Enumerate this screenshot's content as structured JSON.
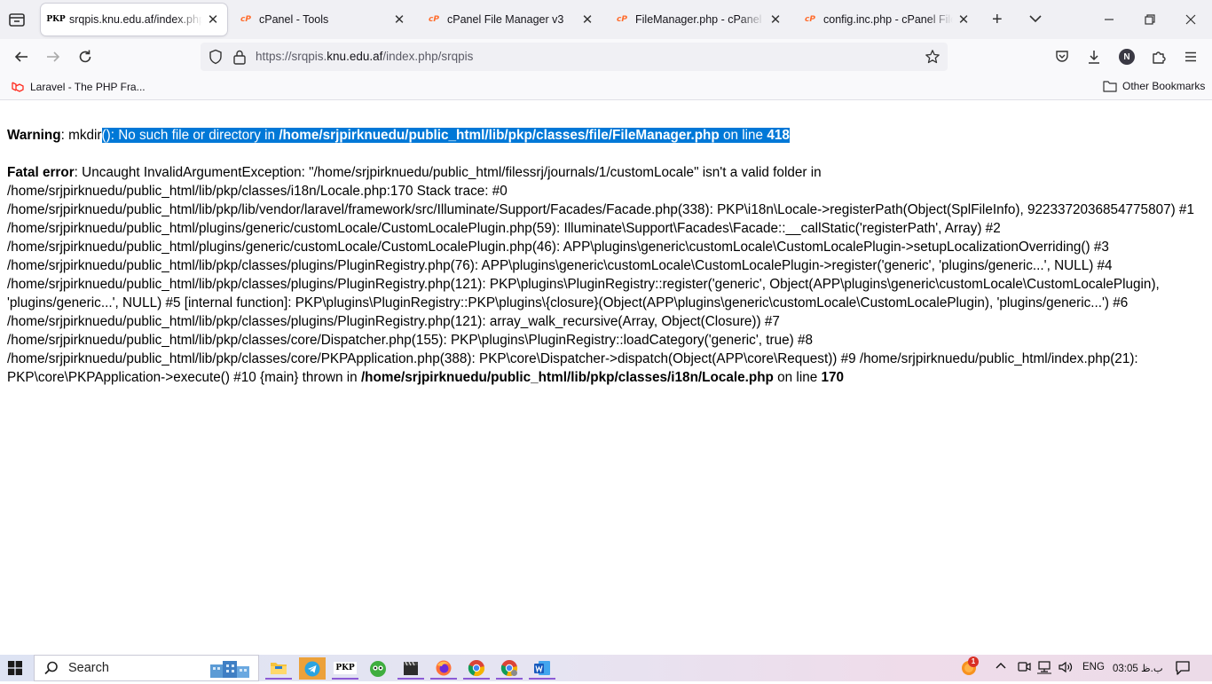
{
  "browser": {
    "tabs": [
      {
        "title": "srqpis.knu.edu.af/index.php/",
        "favicon": "PKP",
        "active": true
      },
      {
        "title": "cPanel - Tools",
        "favicon": "cP",
        "active": false
      },
      {
        "title": "cPanel File Manager v3",
        "favicon": "cP",
        "active": false
      },
      {
        "title": "FileManager.php - cPanel File",
        "favicon": "cP",
        "active": false
      },
      {
        "title": "config.inc.php - cPanel File M",
        "favicon": "cP",
        "active": false
      }
    ],
    "new_tab_symbol": "+",
    "url": {
      "scheme": "https://",
      "subdomain": "srqpis.",
      "host": "knu.edu.af",
      "path": "/index.php/srqpis"
    },
    "profile_initial": "N",
    "bookmarks": [
      {
        "label": "Laravel - The PHP Fra...",
        "icon": "laravel-icon"
      }
    ],
    "other_bookmarks": "Other Bookmarks"
  },
  "page": {
    "warning": {
      "label": "Warning",
      "sep": ": ",
      "func_before": "mkdir",
      "selected_plain": "(): No such file or directory in ",
      "selected_path": "/home/srjpirknuedu/public_html/lib/pkp/classes/file/FileManager.php",
      "selected_online": " on line ",
      "selected_line": "418"
    },
    "fatal": {
      "label": "Fatal error",
      "message": ": Uncaught InvalidArgumentException: \"/home/srjpirknuedu/public_html/filessrj/journals/1/customLocale\" isn't a valid folder in /home/srjpirknuedu/public_html/lib/pkp/classes/i18n/Locale.php:170 Stack trace: #0 /home/srjpirknuedu/public_html/lib/pkp/lib/vendor/laravel/framework/src/Illuminate/Support/Facades/Facade.php(338): PKP\\i18n\\Locale->registerPath(Object(SplFileInfo), 9223372036854775807) #1 /home/srjpirknuedu/public_html/plugins/generic/customLocale/CustomLocalePlugin.php(59): Illuminate\\Support\\Facades\\Facade::__callStatic('registerPath', Array) #2 /home/srjpirknuedu/public_html/plugins/generic/customLocale/CustomLocalePlugin.php(46): APP\\plugins\\generic\\customLocale\\CustomLocalePlugin->setupLocalizationOverriding() #3 /home/srjpirknuedu/public_html/lib/pkp/classes/plugins/PluginRegistry.php(76): APP\\plugins\\generic\\customLocale\\CustomLocalePlugin->register('generic', 'plugins/generic...', NULL) #4 /home/srjpirknuedu/public_html/lib/pkp/classes/plugins/PluginRegistry.php(121): PKP\\plugins\\PluginRegistry::register('generic', Object(APP\\plugins\\generic\\customLocale\\CustomLocalePlugin), 'plugins/generic...', NULL) #5 [internal function]: PKP\\plugins\\PluginRegistry::PKP\\plugins\\{closure}(Object(APP\\plugins\\generic\\customLocale\\CustomLocalePlugin), 'plugins/generic...') #6 /home/srjpirknuedu/public_html/lib/pkp/classes/plugins/PluginRegistry.php(121): array_walk_recursive(Array, Object(Closure)) #7 /home/srjpirknuedu/public_html/lib/pkp/classes/core/Dispatcher.php(155): PKP\\plugins\\PluginRegistry::loadCategory('generic', true) #8 /home/srjpirknuedu/public_html/lib/pkp/classes/core/PKPApplication.php(388): PKP\\core\\Dispatcher->dispatch(Object(APP\\core\\Request)) #9 /home/srjpirknuedu/public_html/index.php(21): PKP\\core\\PKPApplication->execute() #10 {main} thrown in ",
      "file": "/home/srjpirknuedu/public_html/lib/pkp/classes/i18n/Locale.php",
      "online": " on line ",
      "line": "170"
    }
  },
  "taskbar": {
    "search_placeholder": "Search",
    "apps": [
      "file-explorer-icon",
      "telegram-icon",
      "pkp-icon",
      "duo-icon",
      "clapper-icon",
      "firefox-icon",
      "chrome-icon",
      "chrome-profile-icon",
      "word-icon"
    ],
    "pkp_app_label": "PKP",
    "notification_count": "1",
    "language": "ENG",
    "clock": "03:05 ب.ظ"
  },
  "colors": {
    "selection": "#0078d7",
    "cpanel_orange": "#ff6c2c",
    "taskbar_active": "#8c5bd6"
  }
}
